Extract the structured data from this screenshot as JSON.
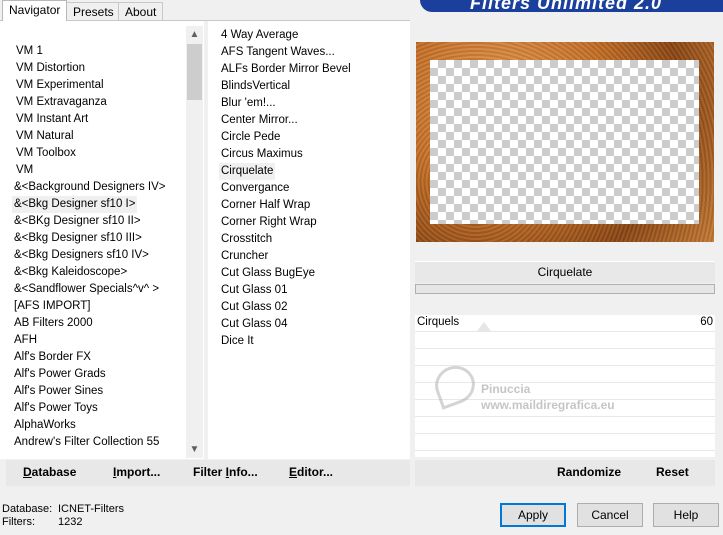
{
  "tabs": [
    "Navigator",
    "Presets",
    "About"
  ],
  "banner_title": "Filters Unlimited 2.0",
  "categories": [
    "VM 1",
    "VM Distortion",
    "VM Experimental",
    "VM Extravaganza",
    "VM Instant Art",
    "VM Natural",
    "VM Toolbox",
    "VM",
    "&<Background Designers IV>",
    "&<Bkg Designer sf10 I>",
    "&<BKg Designer sf10 II>",
    "&<Bkg Designer sf10 III>",
    "&<Bkg Designers sf10 IV>",
    "&<Bkg Kaleidoscope>",
    "&<Sandflower Specials^v^ >",
    "[AFS IMPORT]",
    "AB Filters 2000",
    "AFH",
    "Alf's Border FX",
    "Alf's Power Grads",
    "Alf's Power Sines",
    "Alf's Power Toys",
    "AlphaWorks",
    "Andrew's Filter Collection 55"
  ],
  "selected_category": "&<Bkg Designer sf10 I>",
  "filters": [
    "4 Way Average",
    "AFS Tangent Waves...",
    "ALFs Border Mirror Bevel",
    "BlindsVertical",
    "Blur 'em!...",
    "Center Mirror...",
    "Circle Pede",
    "Circus Maximus",
    "Cirquelate",
    "Convergance",
    "Corner Half Wrap",
    "Corner Right Wrap",
    "Crosstitch",
    "Cruncher",
    "Cut Glass  BugEye",
    "Cut Glass 01",
    "Cut Glass 02",
    "Cut Glass 04",
    "Dice It"
  ],
  "selected_filter": "Cirquelate",
  "filter_title": "Cirquelate",
  "params": [
    {
      "label": "Cirquels",
      "value": "60"
    }
  ],
  "watermark": {
    "line1": "Pinuccia",
    "line2": "www.maildiregrafica.eu"
  },
  "left_buttons": {
    "database": {
      "ul": "D",
      "rest": "atabase"
    },
    "import": {
      "ul": "I",
      "rest": "mport..."
    },
    "filter_info": {
      "pre": "Filter ",
      "ul": "I",
      "rest": "nfo..."
    },
    "editor": {
      "ul": "E",
      "rest": "ditor..."
    }
  },
  "right_buttons": {
    "randomize": "Randomize",
    "reset": "Reset"
  },
  "status": {
    "database_label": "Database:",
    "database_value": "ICNET-Filters",
    "filters_label": "Filters:",
    "filters_value": "1232"
  },
  "dialog_buttons": {
    "apply": "Apply",
    "cancel": "Cancel",
    "help": "Help"
  },
  "colors": {
    "banner": "#1a3f9c",
    "default_button_border": "#0078d7",
    "frame": "#c56f25"
  }
}
